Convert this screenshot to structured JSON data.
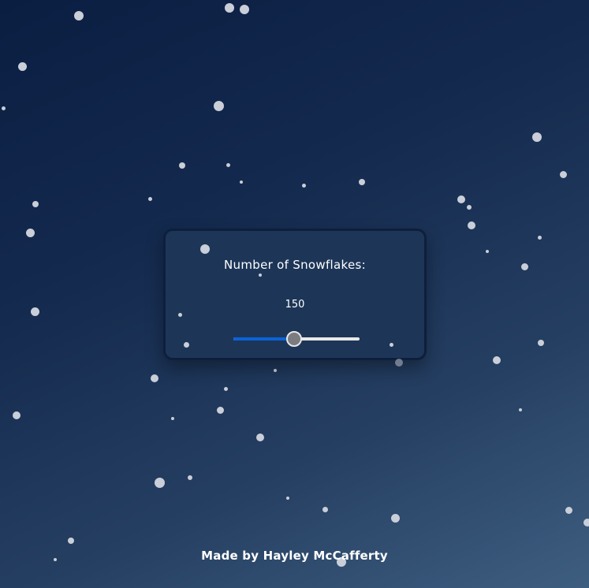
{
  "control": {
    "label": "Number of Snowflakes:",
    "value": "150",
    "slider_fraction": 0.48
  },
  "footer": {
    "credit": "Made by Hayley McCafferty"
  },
  "colors": {
    "background_dark": "#0a1e42",
    "background_light": "#3e5e80",
    "panel": "#1d3658",
    "slider_fill": "#0a63d8",
    "snowflake": "#c9ced8"
  }
}
